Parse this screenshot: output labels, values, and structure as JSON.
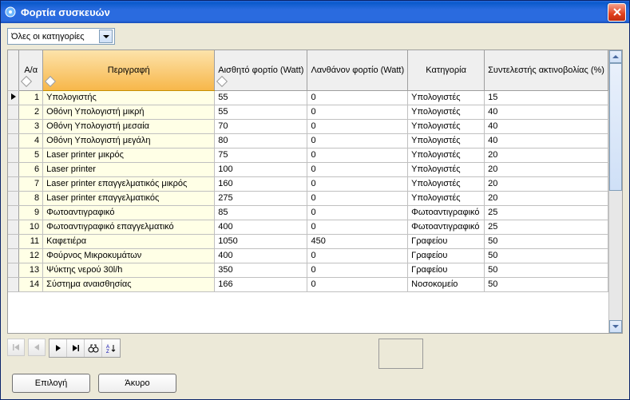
{
  "window": {
    "title": "Φορτία συσκευών"
  },
  "filter": {
    "value": "Όλες οι κατηγορίες"
  },
  "columns": {
    "aa": "Α/α",
    "desc": "Περιγραφή",
    "sensible": "Αισθητό φορτίο (Watt)",
    "latent": "Λανθάνον φορτίο (Watt)",
    "category": "Κατηγορία",
    "radiation": "Συντελεστής ακτινοβολίας (%)"
  },
  "rows": [
    {
      "aa": "1",
      "desc": "Υπολογιστής",
      "s": "55",
      "l": "0",
      "k": "Υπολογιστές",
      "r": "15"
    },
    {
      "aa": "2",
      "desc": "Οθόνη Υπολογιστή μικρή",
      "s": "55",
      "l": "0",
      "k": "Υπολογιστές",
      "r": "40"
    },
    {
      "aa": "3",
      "desc": "Οθόνη Υπολογιστή μεσαία",
      "s": "70",
      "l": "0",
      "k": "Υπολογιστές",
      "r": "40"
    },
    {
      "aa": "4",
      "desc": "Οθόνη Υπολογιστή μεγάλη",
      "s": "80",
      "l": "0",
      "k": "Υπολογιστές",
      "r": "40"
    },
    {
      "aa": "5",
      "desc": "Laser printer μικρός",
      "s": "75",
      "l": "0",
      "k": "Υπολογιστές",
      "r": "20"
    },
    {
      "aa": "6",
      "desc": "Laser printer",
      "s": "100",
      "l": "0",
      "k": "Υπολογιστές",
      "r": "20"
    },
    {
      "aa": "7",
      "desc": "Laser printer επαγγελματικός μικρός",
      "s": "160",
      "l": "0",
      "k": "Υπολογιστές",
      "r": "20"
    },
    {
      "aa": "8",
      "desc": "Laser printer επαγγελματικός",
      "s": "275",
      "l": "0",
      "k": "Υπολογιστές",
      "r": "20"
    },
    {
      "aa": "9",
      "desc": "Φωτοαντιγραφικό",
      "s": "85",
      "l": "0",
      "k": "Φωτοαντιγραφικό",
      "r": "25"
    },
    {
      "aa": "10",
      "desc": "Φωτοαντιγραφικό επαγγελματικό",
      "s": "400",
      "l": "0",
      "k": "Φωτοαντιγραφικό",
      "r": "25"
    },
    {
      "aa": "11",
      "desc": "Καφετιέρα",
      "s": "1050",
      "l": "450",
      "k": "Γραφείου",
      "r": "50"
    },
    {
      "aa": "12",
      "desc": "Φούρνος Μικροκυμάτων",
      "s": "400",
      "l": "0",
      "k": "Γραφείου",
      "r": "50"
    },
    {
      "aa": "13",
      "desc": "Ψύκτης νερού 30l/h",
      "s": "350",
      "l": "0",
      "k": "Γραφείου",
      "r": "50"
    },
    {
      "aa": "14",
      "desc": "Σύστημα αναισθησίας",
      "s": "166",
      "l": "0",
      "k": "Νοσοκομείο",
      "r": "50"
    }
  ],
  "buttons": {
    "select": "Επιλογή",
    "cancel": "Άκυρο"
  }
}
